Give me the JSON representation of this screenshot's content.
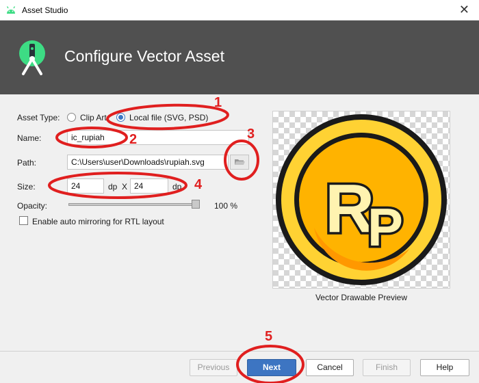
{
  "window": {
    "title": "Asset Studio",
    "close_glyph": "✕"
  },
  "header": {
    "title": "Configure Vector Asset"
  },
  "form": {
    "asset_type_label": "Asset Type:",
    "clip_art_label": "Clip Art",
    "local_file_label": "Local file (SVG, PSD)",
    "selected_asset_type": "Local file (SVG, PSD)",
    "name_label": "Name:",
    "name_value": "ic_rupiah",
    "path_label": "Path:",
    "path_value": "C:\\Users\\user\\Downloads\\rupiah.svg",
    "size_label": "Size:",
    "width_value": "24",
    "height_value": "24",
    "unit": "dp",
    "size_separator": "X",
    "opacity_label": "Opacity:",
    "opacity_value": "100 %",
    "opacity_fraction": 1.0,
    "auto_mirror_label": "Enable auto mirroring for RTL layout",
    "auto_mirror_checked": false
  },
  "preview": {
    "caption": "Vector Drawable Preview",
    "icon_letters_1": "R",
    "icon_letters_2": "P"
  },
  "buttons": {
    "previous": "Previous",
    "next": "Next",
    "cancel": "Cancel",
    "finish": "Finish",
    "help": "Help"
  },
  "annotations": {
    "labels": [
      "1",
      "2",
      "3",
      "4",
      "5"
    ],
    "color": "#e01f1f"
  },
  "colors": {
    "header_bg": "#505050",
    "primary_button": "#3d75c2",
    "radio_selected": "#3a75c4",
    "android_green": "#3ddc84"
  }
}
